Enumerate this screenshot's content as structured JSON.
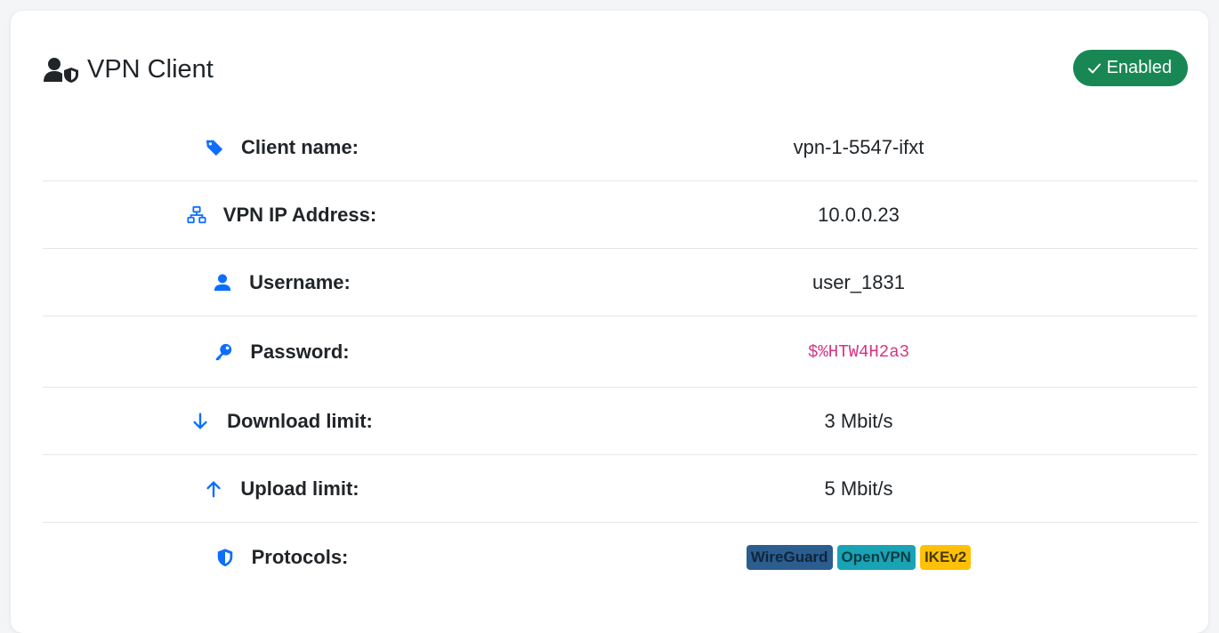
{
  "card": {
    "title": "VPN Client",
    "header_icon": "user-shield-icon",
    "status": {
      "label": "Enabled",
      "icon": "check-icon",
      "color": "#198754"
    }
  },
  "accent_color": "#0d6efd",
  "rows": [
    {
      "label": "Client name:",
      "value": "vpn-1-5547-ifxt",
      "icon": "tag-icon"
    },
    {
      "label": "VPN IP Address:",
      "value": "10.0.0.23",
      "icon": "network-icon"
    },
    {
      "label": "Username:",
      "value": "user_1831",
      "icon": "user-icon"
    },
    {
      "label": "Password:",
      "value": "$%HTW4H2a3",
      "icon": "key-icon"
    },
    {
      "label": "Download limit:",
      "value": "3 Mbit/s",
      "icon": "arrow-down-icon"
    },
    {
      "label": "Upload limit:",
      "value": "5 Mbit/s",
      "icon": "arrow-up-icon"
    },
    {
      "label": "Protocols:",
      "icon": "shield-icon",
      "tags": [
        {
          "label": "WireGuard",
          "color": "#2b5d8f"
        },
        {
          "label": "OpenVPN",
          "color": "#1aa3b5"
        },
        {
          "label": "IKEv2",
          "color": "#ffc107"
        }
      ]
    }
  ]
}
